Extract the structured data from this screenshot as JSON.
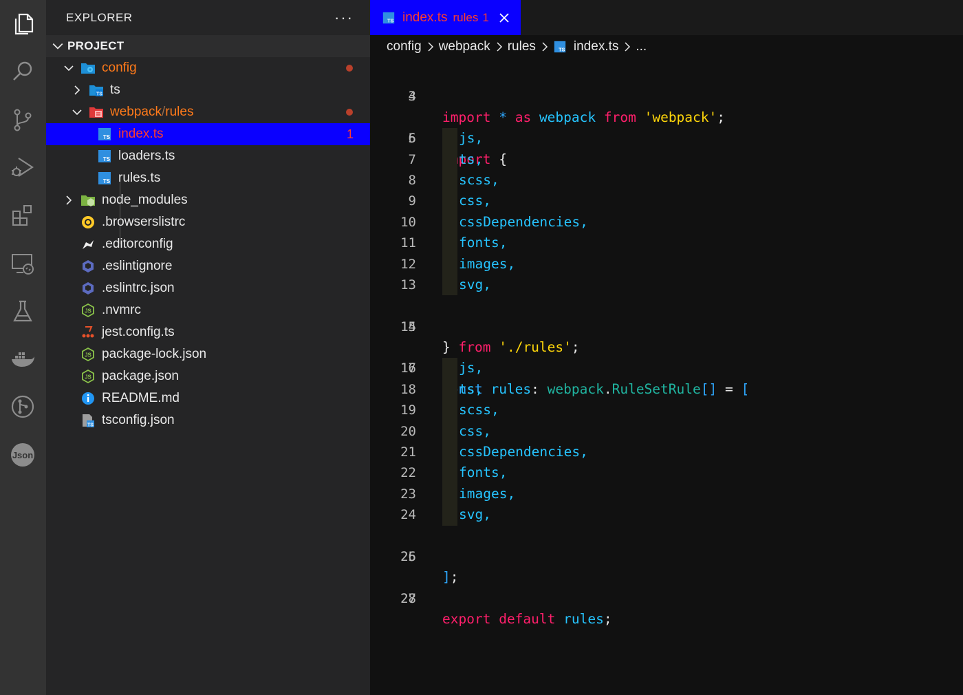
{
  "activity_bar": {
    "items": [
      {
        "icon": "explorer-icon"
      },
      {
        "icon": "search-icon"
      },
      {
        "icon": "source-control-icon"
      },
      {
        "icon": "run-debug-icon"
      },
      {
        "icon": "extensions-icon"
      },
      {
        "icon": "remote-explorer-icon"
      },
      {
        "icon": "testing-icon"
      },
      {
        "icon": "docker-icon"
      },
      {
        "icon": "git-graph-icon"
      },
      {
        "icon": "json-icon",
        "label": "Json"
      }
    ]
  },
  "sidebar": {
    "title": "EXPLORER",
    "more": "···",
    "section_title": "PROJECT",
    "tree": [
      {
        "label": "config",
        "color": "#ff7a1a",
        "badge": "dot"
      },
      {
        "label": "ts",
        "color": "#e8e8e8"
      },
      {
        "label_parts": [
          "webpack",
          "/",
          "rules"
        ],
        "color": "#ff7a1a",
        "badge": "dot"
      },
      {
        "label": "index.ts",
        "color": "#ff3b2e",
        "badge_count": "1"
      },
      {
        "label": "loaders.ts",
        "color": "#e8e8e8"
      },
      {
        "label": "rules.ts",
        "color": "#e8e8e8"
      },
      {
        "label": "node_modules",
        "color": "#e8e8e8"
      },
      {
        "label": ".browserslistrc",
        "color": "#e8e8e8"
      },
      {
        "label": ".editorconfig",
        "color": "#e8e8e8"
      },
      {
        "label": ".eslintignore",
        "color": "#e8e8e8"
      },
      {
        "label": ".eslintrc.json",
        "color": "#e8e8e8"
      },
      {
        "label": ".nvmrc",
        "color": "#e8e8e8"
      },
      {
        "label": "jest.config.ts",
        "color": "#e8e8e8"
      },
      {
        "label": "package-lock.json",
        "color": "#e8e8e8"
      },
      {
        "label": "package.json",
        "color": "#e8e8e8"
      },
      {
        "label": "README.md",
        "color": "#e8e8e8"
      },
      {
        "label": "tsconfig.json",
        "color": "#e8e8e8"
      }
    ]
  },
  "tab": {
    "name": "index.ts",
    "description": "rules",
    "problem_count": "1"
  },
  "breadcrumb": [
    "config",
    "webpack",
    "rules",
    "index.ts",
    "..."
  ],
  "code": {
    "line_numbers": [
      "3",
      "4",
      "5",
      "6",
      "7",
      "8",
      "9",
      "10",
      "11",
      "12",
      "13",
      "14",
      "15",
      "16",
      "17",
      "18",
      "19",
      "20",
      "21",
      "22",
      "23",
      "24",
      "25",
      "26",
      "27",
      "28"
    ],
    "l3": {
      "k1": "import",
      "k2": "*",
      "k3": "as",
      "id": "webpack",
      "k4": "from",
      "str": "'webpack'",
      "end": ";"
    },
    "l5": {
      "k1": "import",
      "brace": "{"
    },
    "list1": [
      "js,",
      "ts,",
      "scss,",
      "css,",
      "cssDependencies,",
      "fonts,",
      "images,",
      "svg,"
    ],
    "l14": {
      "brace": "}",
      "k1": "from",
      "str": "'./rules'",
      "end": ";"
    },
    "l16": {
      "k1": "const",
      "id": "rules",
      "colon": ":",
      "ns": "webpack",
      "dot": ".",
      "type": "RuleSetRule",
      "arr": "[]",
      "eq": "=",
      "open": "["
    },
    "list2": [
      "js,",
      "ts,",
      "scss,",
      "css,",
      "cssDependencies,",
      "fonts,",
      "images,",
      "svg,"
    ],
    "l25": {
      "close": "]",
      "end": ";"
    },
    "l27": {
      "k1": "export",
      "k2": "default",
      "id": "rules",
      "end": ";"
    }
  },
  "colors": {
    "accent_selection": "#0a00ff",
    "error_red": "#ff3b2e",
    "folder_modified": "#ff7a1a",
    "keyword": "#ff1f6b",
    "identifier": "#26c4ff",
    "string": "#ffd60a",
    "type": "#20b4a0"
  }
}
